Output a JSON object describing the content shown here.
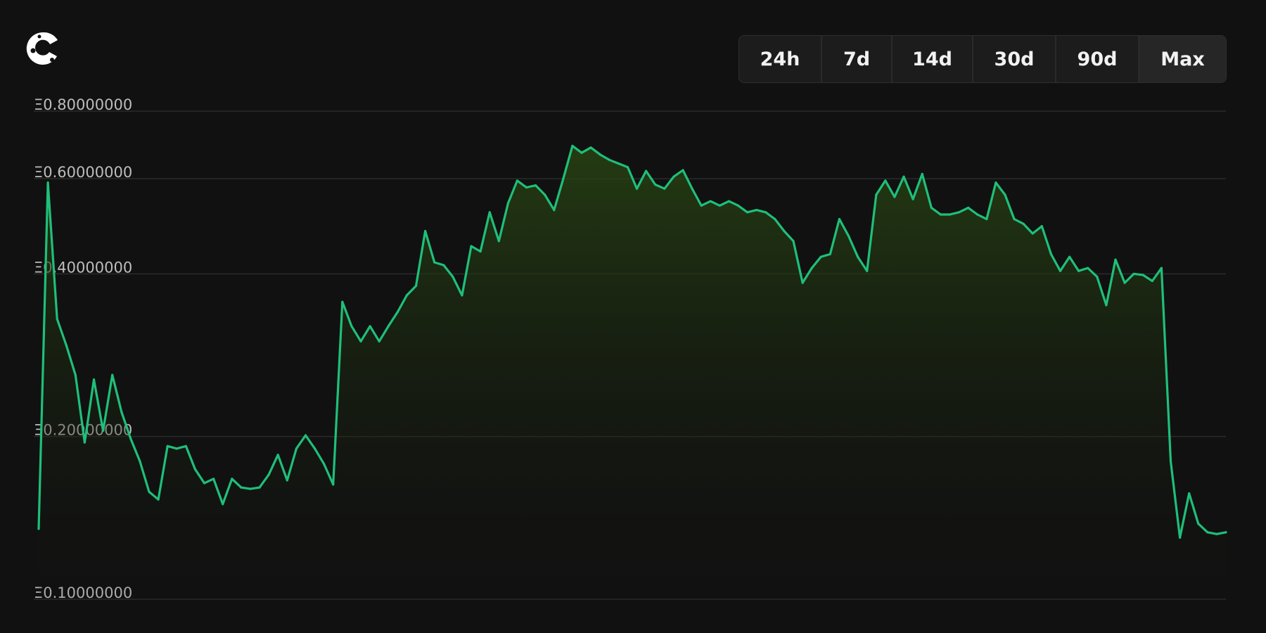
{
  "brand": {
    "logo_icon": "coingecko-style-c-logo-icon"
  },
  "range_buttons": [
    {
      "label": "24h",
      "active": false
    },
    {
      "label": "7d",
      "active": false
    },
    {
      "label": "14d",
      "active": false
    },
    {
      "label": "30d",
      "active": false
    },
    {
      "label": "90d",
      "active": false
    },
    {
      "label": "Max",
      "active": true
    }
  ],
  "colors": {
    "background": "#111111",
    "line": "#1fbf7a",
    "fill_top": "#2a4a12",
    "grid": "#2b2b2b",
    "tick_text": "#bdbdbd"
  },
  "chart_data": {
    "type": "area",
    "title": "",
    "xlabel": "",
    "ylabel": "",
    "y_scale": "log",
    "ylim": [
      0.1,
      0.8
    ],
    "y_ticks": [
      {
        "value": 0.8,
        "label": "Ξ0.80000000"
      },
      {
        "value": 0.6,
        "label": "Ξ0.60000000"
      },
      {
        "value": 0.4,
        "label": "Ξ0.40000000"
      },
      {
        "value": 0.2,
        "label": "Ξ0.20000000"
      },
      {
        "value": 0.1,
        "label": "Ξ0.10000000"
      }
    ],
    "grid": true,
    "series": [
      {
        "values": [
          0.135,
          0.59,
          0.33,
          0.295,
          0.26,
          0.195,
          0.255,
          0.205,
          0.26,
          0.222,
          0.198,
          0.18,
          0.158,
          0.153,
          0.192,
          0.19,
          0.192,
          0.174,
          0.164,
          0.167,
          0.15,
          0.167,
          0.161,
          0.16,
          0.161,
          0.17,
          0.185,
          0.166,
          0.19,
          0.201,
          0.19,
          0.178,
          0.163,
          0.355,
          0.32,
          0.3,
          0.32,
          0.3,
          0.32,
          0.34,
          0.365,
          0.38,
          0.48,
          0.42,
          0.415,
          0.395,
          0.365,
          0.45,
          0.44,
          0.52,
          0.46,
          0.54,
          0.595,
          0.578,
          0.583,
          0.56,
          0.525,
          0.6,
          0.69,
          0.67,
          0.685,
          0.665,
          0.65,
          0.64,
          0.63,
          0.575,
          0.62,
          0.585,
          0.575,
          0.605,
          0.622,
          0.575,
          0.535,
          0.545,
          0.535,
          0.545,
          0.535,
          0.52,
          0.525,
          0.52,
          0.505,
          0.48,
          0.46,
          0.385,
          0.41,
          0.43,
          0.435,
          0.505,
          0.47,
          0.43,
          0.405,
          0.56,
          0.595,
          0.555,
          0.605,
          0.55,
          0.612,
          0.53,
          0.515,
          0.515,
          0.52,
          0.53,
          0.515,
          0.505,
          0.59,
          0.56,
          0.505,
          0.495,
          0.475,
          0.49,
          0.435,
          0.405,
          0.43,
          0.405,
          0.41,
          0.395,
          0.35,
          0.425,
          0.385,
          0.4,
          0.398,
          0.388,
          0.41,
          0.18,
          0.13,
          0.157,
          0.138,
          0.133,
          0.132,
          0.133
        ]
      }
    ]
  }
}
